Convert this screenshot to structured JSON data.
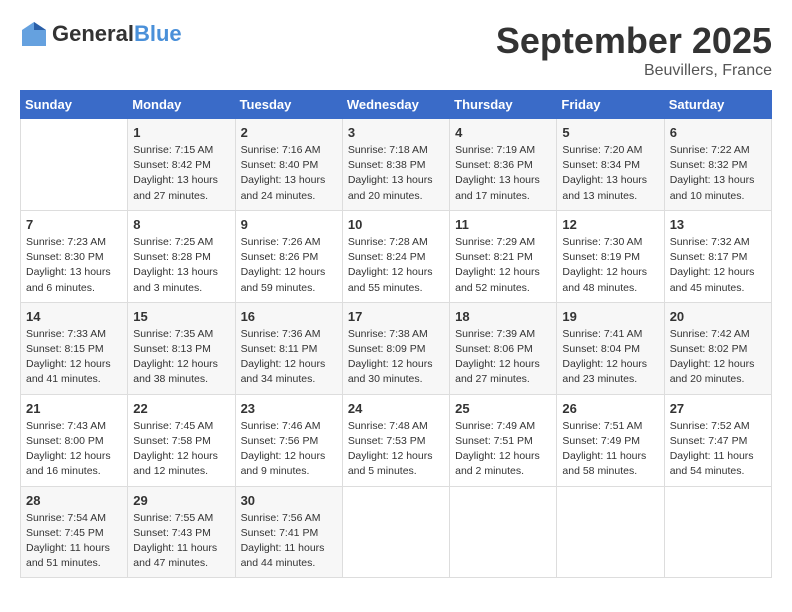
{
  "header": {
    "logo": {
      "general": "General",
      "blue": "Blue"
    },
    "title": "September 2025",
    "location": "Beuvillers, France"
  },
  "calendar": {
    "days_of_week": [
      "Sunday",
      "Monday",
      "Tuesday",
      "Wednesday",
      "Thursday",
      "Friday",
      "Saturday"
    ],
    "weeks": [
      [
        {
          "day": "",
          "info": ""
        },
        {
          "day": "1",
          "info": "Sunrise: 7:15 AM\nSunset: 8:42 PM\nDaylight: 13 hours\nand 27 minutes."
        },
        {
          "day": "2",
          "info": "Sunrise: 7:16 AM\nSunset: 8:40 PM\nDaylight: 13 hours\nand 24 minutes."
        },
        {
          "day": "3",
          "info": "Sunrise: 7:18 AM\nSunset: 8:38 PM\nDaylight: 13 hours\nand 20 minutes."
        },
        {
          "day": "4",
          "info": "Sunrise: 7:19 AM\nSunset: 8:36 PM\nDaylight: 13 hours\nand 17 minutes."
        },
        {
          "day": "5",
          "info": "Sunrise: 7:20 AM\nSunset: 8:34 PM\nDaylight: 13 hours\nand 13 minutes."
        },
        {
          "day": "6",
          "info": "Sunrise: 7:22 AM\nSunset: 8:32 PM\nDaylight: 13 hours\nand 10 minutes."
        }
      ],
      [
        {
          "day": "7",
          "info": "Sunrise: 7:23 AM\nSunset: 8:30 PM\nDaylight: 13 hours\nand 6 minutes."
        },
        {
          "day": "8",
          "info": "Sunrise: 7:25 AM\nSunset: 8:28 PM\nDaylight: 13 hours\nand 3 minutes."
        },
        {
          "day": "9",
          "info": "Sunrise: 7:26 AM\nSunset: 8:26 PM\nDaylight: 12 hours\nand 59 minutes."
        },
        {
          "day": "10",
          "info": "Sunrise: 7:28 AM\nSunset: 8:24 PM\nDaylight: 12 hours\nand 55 minutes."
        },
        {
          "day": "11",
          "info": "Sunrise: 7:29 AM\nSunset: 8:21 PM\nDaylight: 12 hours\nand 52 minutes."
        },
        {
          "day": "12",
          "info": "Sunrise: 7:30 AM\nSunset: 8:19 PM\nDaylight: 12 hours\nand 48 minutes."
        },
        {
          "day": "13",
          "info": "Sunrise: 7:32 AM\nSunset: 8:17 PM\nDaylight: 12 hours\nand 45 minutes."
        }
      ],
      [
        {
          "day": "14",
          "info": "Sunrise: 7:33 AM\nSunset: 8:15 PM\nDaylight: 12 hours\nand 41 minutes."
        },
        {
          "day": "15",
          "info": "Sunrise: 7:35 AM\nSunset: 8:13 PM\nDaylight: 12 hours\nand 38 minutes."
        },
        {
          "day": "16",
          "info": "Sunrise: 7:36 AM\nSunset: 8:11 PM\nDaylight: 12 hours\nand 34 minutes."
        },
        {
          "day": "17",
          "info": "Sunrise: 7:38 AM\nSunset: 8:09 PM\nDaylight: 12 hours\nand 30 minutes."
        },
        {
          "day": "18",
          "info": "Sunrise: 7:39 AM\nSunset: 8:06 PM\nDaylight: 12 hours\nand 27 minutes."
        },
        {
          "day": "19",
          "info": "Sunrise: 7:41 AM\nSunset: 8:04 PM\nDaylight: 12 hours\nand 23 minutes."
        },
        {
          "day": "20",
          "info": "Sunrise: 7:42 AM\nSunset: 8:02 PM\nDaylight: 12 hours\nand 20 minutes."
        }
      ],
      [
        {
          "day": "21",
          "info": "Sunrise: 7:43 AM\nSunset: 8:00 PM\nDaylight: 12 hours\nand 16 minutes."
        },
        {
          "day": "22",
          "info": "Sunrise: 7:45 AM\nSunset: 7:58 PM\nDaylight: 12 hours\nand 12 minutes."
        },
        {
          "day": "23",
          "info": "Sunrise: 7:46 AM\nSunset: 7:56 PM\nDaylight: 12 hours\nand 9 minutes."
        },
        {
          "day": "24",
          "info": "Sunrise: 7:48 AM\nSunset: 7:53 PM\nDaylight: 12 hours\nand 5 minutes."
        },
        {
          "day": "25",
          "info": "Sunrise: 7:49 AM\nSunset: 7:51 PM\nDaylight: 12 hours\nand 2 minutes."
        },
        {
          "day": "26",
          "info": "Sunrise: 7:51 AM\nSunset: 7:49 PM\nDaylight: 11 hours\nand 58 minutes."
        },
        {
          "day": "27",
          "info": "Sunrise: 7:52 AM\nSunset: 7:47 PM\nDaylight: 11 hours\nand 54 minutes."
        }
      ],
      [
        {
          "day": "28",
          "info": "Sunrise: 7:54 AM\nSunset: 7:45 PM\nDaylight: 11 hours\nand 51 minutes."
        },
        {
          "day": "29",
          "info": "Sunrise: 7:55 AM\nSunset: 7:43 PM\nDaylight: 11 hours\nand 47 minutes."
        },
        {
          "day": "30",
          "info": "Sunrise: 7:56 AM\nSunset: 7:41 PM\nDaylight: 11 hours\nand 44 minutes."
        },
        {
          "day": "",
          "info": ""
        },
        {
          "day": "",
          "info": ""
        },
        {
          "day": "",
          "info": ""
        },
        {
          "day": "",
          "info": ""
        }
      ]
    ]
  }
}
